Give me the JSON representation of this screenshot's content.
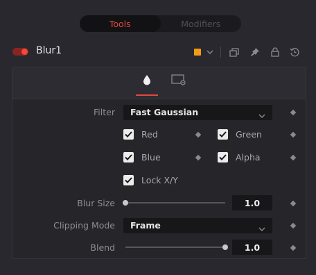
{
  "top_tabs": [
    {
      "label": "Tools",
      "active": true
    },
    {
      "label": "Modifiers",
      "active": false
    }
  ],
  "tool": {
    "name": "Blur1",
    "enabled": true,
    "color_swatch": "#f59a17"
  },
  "panel_tabs": [
    {
      "icon": "drop-icon",
      "active": true
    },
    {
      "icon": "settings-panel-icon",
      "active": false
    }
  ],
  "controls": {
    "filter": {
      "label": "Filter",
      "value": "Fast Gaussian"
    },
    "channels": [
      {
        "label": "Red",
        "checked": true
      },
      {
        "label": "Green",
        "checked": true
      },
      {
        "label": "Blue",
        "checked": true
      },
      {
        "label": "Alpha",
        "checked": true
      }
    ],
    "lock_xy": {
      "label": "Lock X/Y",
      "checked": true
    },
    "blur_size": {
      "label": "Blur Size",
      "value": "1.0",
      "slider_fraction": 0.0
    },
    "clipping_mode": {
      "label": "Clipping Mode",
      "value": "Frame"
    },
    "blend": {
      "label": "Blend",
      "value": "1.0",
      "slider_fraction": 1.0
    }
  },
  "colors": {
    "accent": "#e0493e",
    "background": "#28282e",
    "field": "#17171a"
  }
}
